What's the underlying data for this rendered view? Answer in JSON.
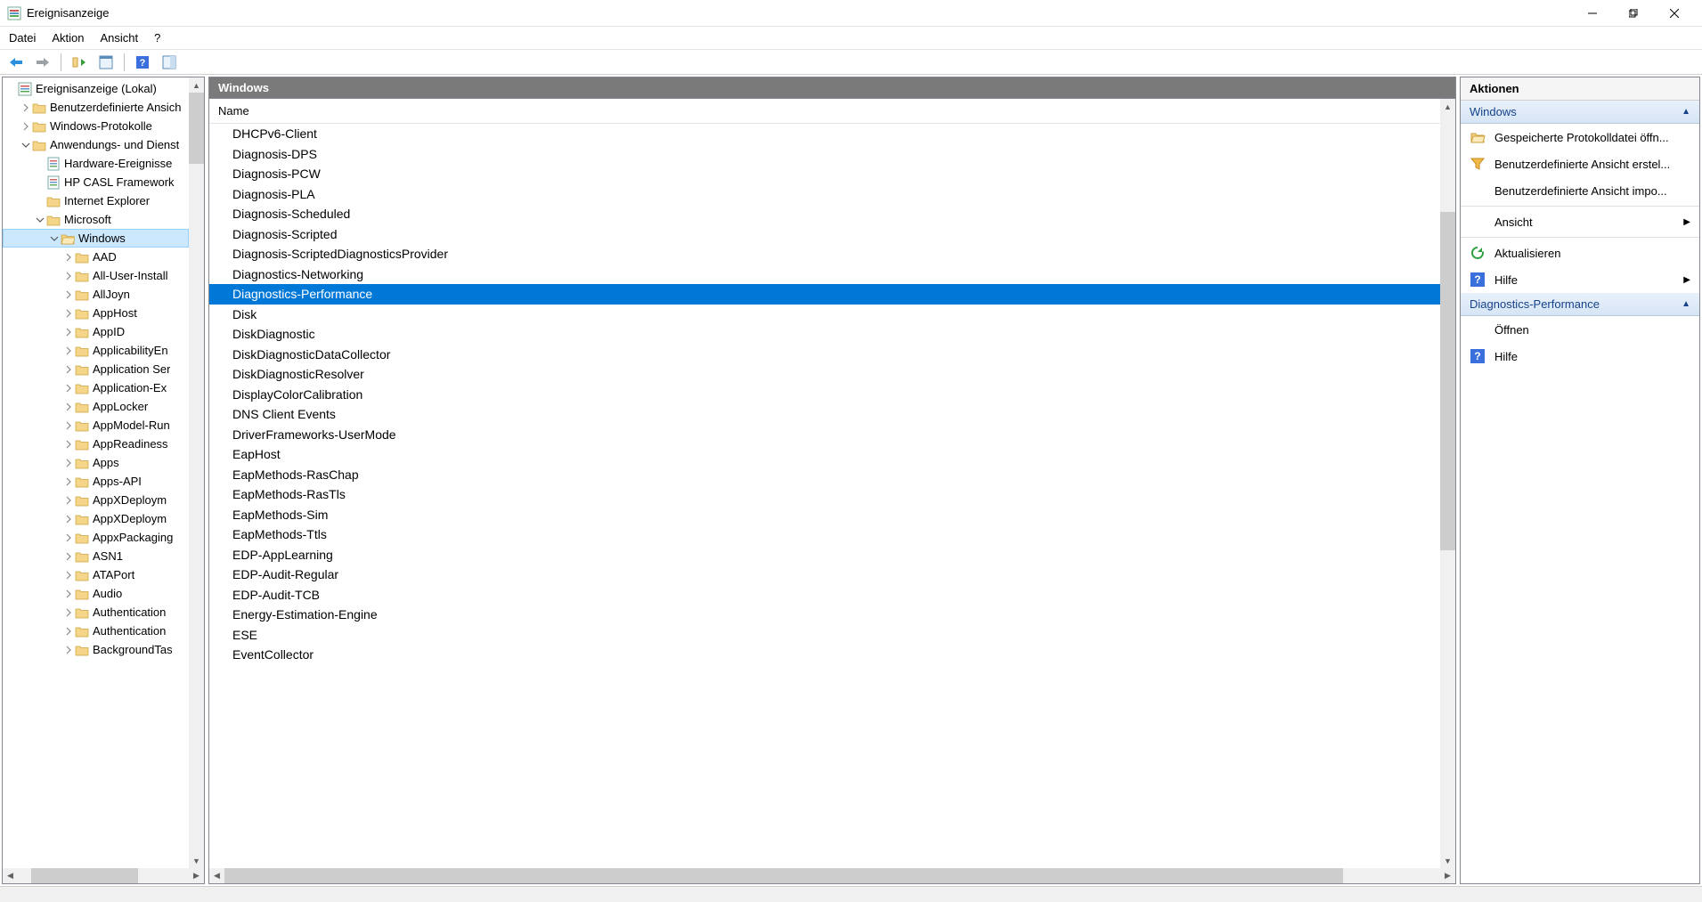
{
  "window": {
    "title": "Ereignisanzeige"
  },
  "menu": {
    "file": "Datei",
    "action": "Aktion",
    "view": "Ansicht",
    "help": "?"
  },
  "tree": {
    "root": "Ereignisanzeige (Lokal)",
    "custom": "Benutzerdefinierte Ansich",
    "winlogs": "Windows-Protokolle",
    "appserv": "Anwendungs- und Dienst",
    "hardware": "Hardware-Ereignisse",
    "hpcasl": "HP CASL Framework",
    "ie": "Internet Explorer",
    "microsoft": "Microsoft",
    "windows": "Windows",
    "items": [
      "AAD",
      "All-User-Install",
      "AllJoyn",
      "AppHost",
      "AppID",
      "ApplicabilityEn",
      "Application Ser",
      "Application-Ex",
      "AppLocker",
      "AppModel-Run",
      "AppReadiness",
      "Apps",
      "Apps-API",
      "AppXDeploym",
      "AppXDeploym",
      "AppxPackaging",
      "ASN1",
      "ATAPort",
      "Audio",
      "Authentication",
      "Authentication",
      "BackgroundTas"
    ]
  },
  "center": {
    "header": "Windows",
    "column": "Name",
    "selected_index": 8,
    "items": [
      "DHCPv6-Client",
      "Diagnosis-DPS",
      "Diagnosis-PCW",
      "Diagnosis-PLA",
      "Diagnosis-Scheduled",
      "Diagnosis-Scripted",
      "Diagnosis-ScriptedDiagnosticsProvider",
      "Diagnostics-Networking",
      "Diagnostics-Performance",
      "Disk",
      "DiskDiagnostic",
      "DiskDiagnosticDataCollector",
      "DiskDiagnosticResolver",
      "DisplayColorCalibration",
      "DNS Client Events",
      "DriverFrameworks-UserMode",
      "EapHost",
      "EapMethods-RasChap",
      "EapMethods-RasTls",
      "EapMethods-Sim",
      "EapMethods-Ttls",
      "EDP-AppLearning",
      "EDP-Audit-Regular",
      "EDP-Audit-TCB",
      "Energy-Estimation-Engine",
      "ESE",
      "EventCollector"
    ]
  },
  "actions": {
    "header": "Aktionen",
    "section1": "Windows",
    "open_saved": "Gespeicherte Protokolldatei öffn...",
    "create_view": "Benutzerdefinierte Ansicht erstel...",
    "import_view": "Benutzerdefinierte Ansicht impo...",
    "view": "Ansicht",
    "refresh": "Aktualisieren",
    "help": "Hilfe",
    "section2": "Diagnostics-Performance",
    "open": "Öffnen",
    "help2": "Hilfe"
  }
}
